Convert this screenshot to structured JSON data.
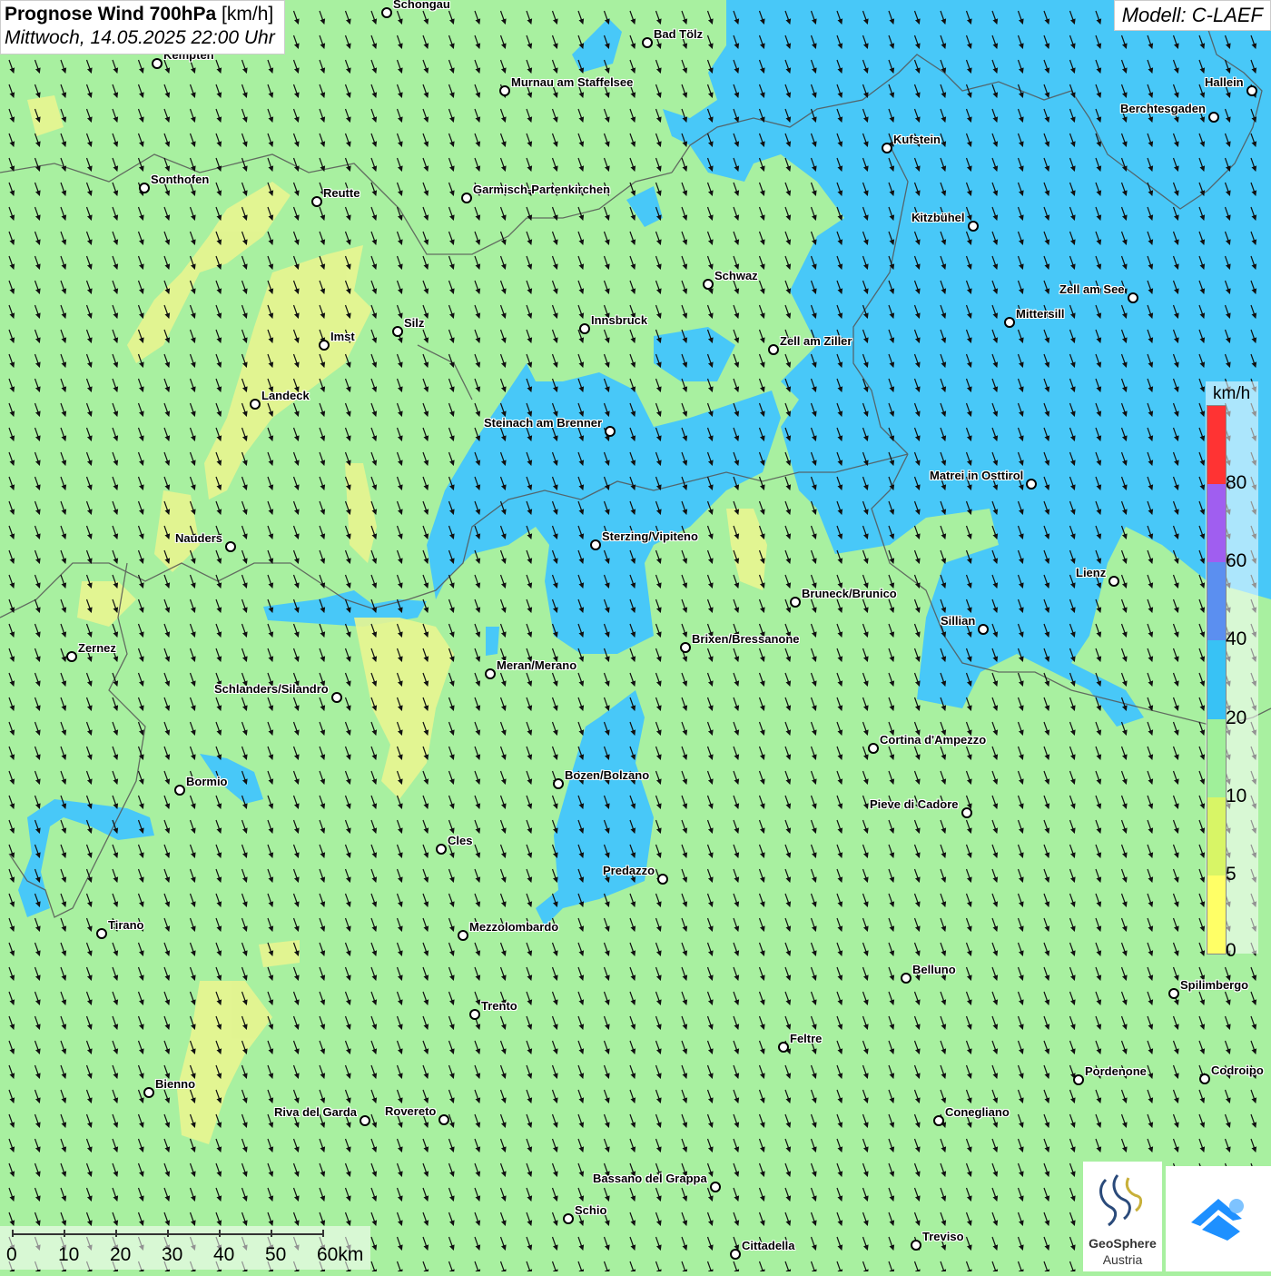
{
  "title": {
    "main": "Prognose Wind 700hPa",
    "unit": "[km/h]",
    "datetime": "Mittwoch, 14.05.2025 22:00 Uhr"
  },
  "model": "Modell: C-LAEF",
  "legend": {
    "unit": "km/h",
    "labels": [
      "80",
      "60",
      "40",
      "20",
      "10",
      "5",
      "0"
    ],
    "colors": [
      "#ff3333",
      "#a05ef0",
      "#5b8ff0",
      "#38c2f5",
      "#a0f09a",
      "#d8f566",
      "#ffff66"
    ]
  },
  "scalebar": {
    "labels": [
      "0",
      "10",
      "20",
      "30",
      "40",
      "50",
      "60km"
    ]
  },
  "logo": {
    "line1": "GeoSphere",
    "line2": "Austria"
  },
  "colors": {
    "wind_10_20": "#a8f0a0",
    "wind_20_40": "#48c8f8",
    "wind_5_10": "#e8f590",
    "arrow": "#111111",
    "border": "#555555"
  },
  "wind_direction": "from north-northwest",
  "cities": [
    {
      "name": "Schongau"
    },
    {
      "name": "Bad Tölz"
    },
    {
      "name": "Kempten"
    },
    {
      "name": "Murnau am Staffelsee"
    },
    {
      "name": "Hallein"
    },
    {
      "name": "Berchtesgaden"
    },
    {
      "name": "Kufstein"
    },
    {
      "name": "Sonthofen"
    },
    {
      "name": "Reutte"
    },
    {
      "name": "Garmisch-Partenkirchen"
    },
    {
      "name": "Kitzbühel"
    },
    {
      "name": "Schwaz"
    },
    {
      "name": "Zell am See"
    },
    {
      "name": "Silz"
    },
    {
      "name": "Innsbruck"
    },
    {
      "name": "Mittersill"
    },
    {
      "name": "Imst"
    },
    {
      "name": "Zell am Ziller"
    },
    {
      "name": "Landeck"
    },
    {
      "name": "Steinach am Brenner"
    },
    {
      "name": "Matrei in Osttirol"
    },
    {
      "name": "Nauders"
    },
    {
      "name": "Sterzing/Vipiteno"
    },
    {
      "name": "Lienz"
    },
    {
      "name": "Bruneck/Brunico"
    },
    {
      "name": "Sillian"
    },
    {
      "name": "Brixen/Bressanone"
    },
    {
      "name": "Zernez"
    },
    {
      "name": "Meran/Merano"
    },
    {
      "name": "Schlanders/Silandro"
    },
    {
      "name": "Cortina d'Ampezzo"
    },
    {
      "name": "Bozen/Bolzano"
    },
    {
      "name": "Bormio"
    },
    {
      "name": "Pieve di Cadore"
    },
    {
      "name": "Cles"
    },
    {
      "name": "Predazzo"
    },
    {
      "name": "Tirano"
    },
    {
      "name": "Mezzolombardo"
    },
    {
      "name": "Belluno"
    },
    {
      "name": "Spilimbergo"
    },
    {
      "name": "Trento"
    },
    {
      "name": "Feltre"
    },
    {
      "name": "Pordenone"
    },
    {
      "name": "Codroipo"
    },
    {
      "name": "Bienno"
    },
    {
      "name": "Riva del Garda"
    },
    {
      "name": "Rovereto"
    },
    {
      "name": "Conegliano"
    },
    {
      "name": "Bassano del Grappa"
    },
    {
      "name": "Schio"
    },
    {
      "name": "Treviso"
    },
    {
      "name": "Cittadella"
    }
  ]
}
